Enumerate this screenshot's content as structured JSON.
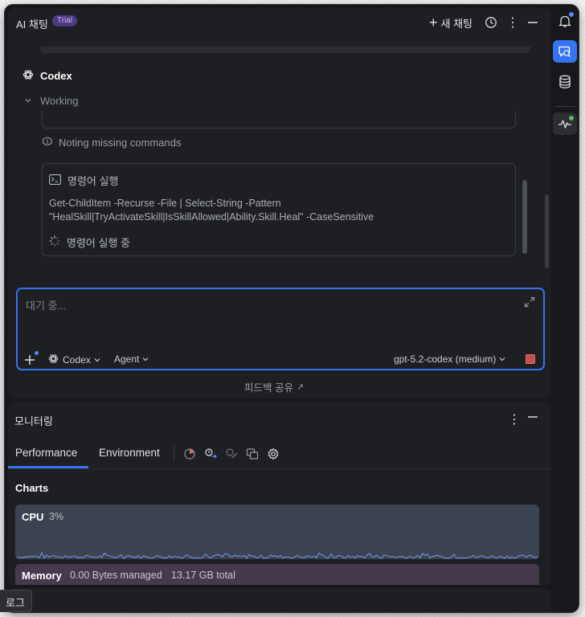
{
  "chat": {
    "title": "AI 채팅",
    "badge": "Trial",
    "new_chat_label": "새 채팅",
    "icons": {
      "new": "plus-icon",
      "history": "clock-icon",
      "more": "more-vertical-icon",
      "minimize": "minimize-icon"
    }
  },
  "thread": {
    "agent_name": "Codex",
    "working_label": "Working",
    "thinking_label": "Noting missing commands",
    "command": {
      "header": "명령어 실행",
      "text": "Get-ChildItem -Recurse -File | Select-String -Pattern \"HealSkill|TryActivateSkill|IsSkillAllowed|Ability.Skill.Heal\" -CaseSensitive",
      "status": "명령어 실행 중"
    }
  },
  "input": {
    "placeholder": "대기 중...",
    "provider": "Codex",
    "mode": "Agent",
    "model": "gpt-5.2-codex (medium)",
    "accent": "#3574f0"
  },
  "feedback": {
    "label": "피드백 공유",
    "arrow": "↗"
  },
  "monitor": {
    "title": "모니터링",
    "tabs": [
      "Performance",
      "Environment"
    ],
    "active_tab": "Performance",
    "charts_title": "Charts",
    "cpu": {
      "label": "CPU",
      "value": "3%"
    },
    "memory": {
      "label": "Memory",
      "managed": "0.00 Bytes managed",
      "total": "13.17 GB total"
    }
  },
  "bottom": {
    "log_tab": "로그"
  },
  "right_toolbar": [
    "bell-icon",
    "ai-chat-icon",
    "database-icon",
    "pulse-icon"
  ]
}
